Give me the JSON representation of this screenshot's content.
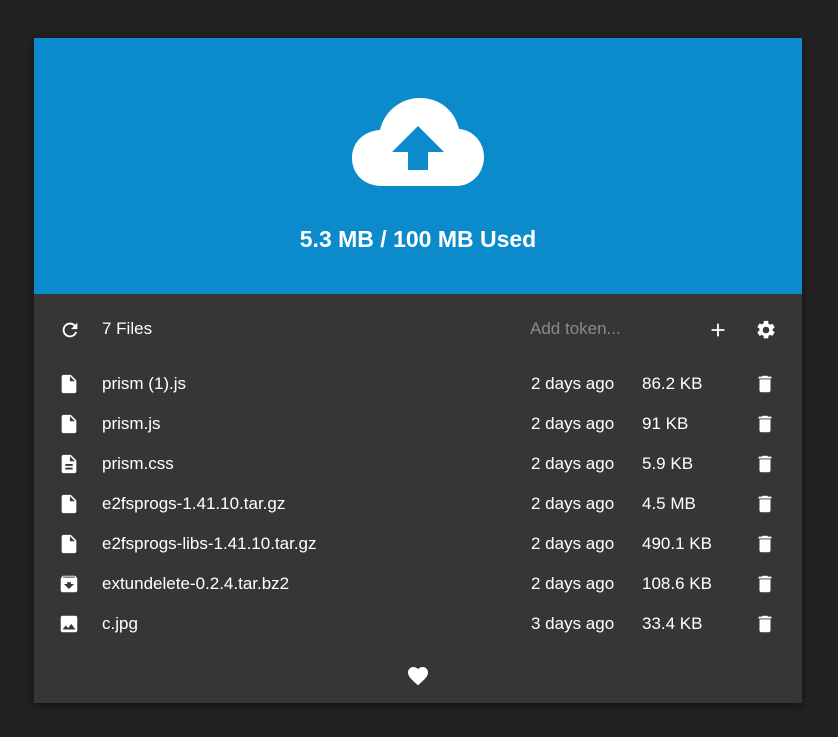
{
  "header": {
    "usage_text": "5.3 MB / 100 MB Used",
    "accent_color": "#0b8bcc",
    "upload_icon": "cloud-upload-icon"
  },
  "toolbar": {
    "refresh_icon": "refresh-icon",
    "files_count": "7 Files",
    "token_placeholder": "Add token...",
    "token_value": "",
    "add_icon": "plus-icon",
    "settings_icon": "gear-icon"
  },
  "files": [
    {
      "name": "prism (1).js",
      "date": "2 days ago",
      "size": "86.2 KB",
      "icon": "file-icon"
    },
    {
      "name": "prism.js",
      "date": "2 days ago",
      "size": "91 KB",
      "icon": "file-icon"
    },
    {
      "name": "prism.css",
      "date": "2 days ago",
      "size": "5.9 KB",
      "icon": "file-text-icon"
    },
    {
      "name": "e2fsprogs-1.41.10.tar.gz",
      "date": "2 days ago",
      "size": "4.5 MB",
      "icon": "file-icon"
    },
    {
      "name": "e2fsprogs-libs-1.41.10.tar.gz",
      "date": "2 days ago",
      "size": "490.1 KB",
      "icon": "file-icon"
    },
    {
      "name": "extundelete-0.2.4.tar.bz2",
      "date": "2 days ago",
      "size": "108.6 KB",
      "icon": "archive-icon"
    },
    {
      "name": "c.jpg",
      "date": "3 days ago",
      "size": "33.4 KB",
      "icon": "image-icon"
    }
  ],
  "footer": {
    "heart_icon": "heart-icon"
  }
}
